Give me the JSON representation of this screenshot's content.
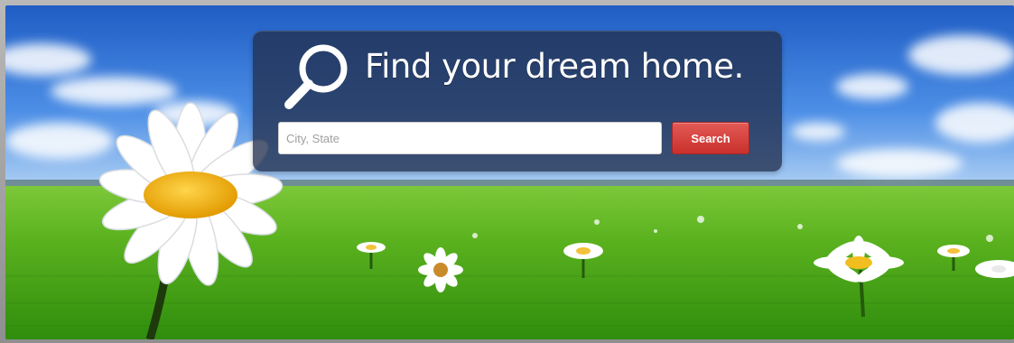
{
  "hero": {
    "background_image": "meadow-with-daisies-under-blue-sky",
    "colors": {
      "sky": "#2f6fd0",
      "grass": "#5fb11e",
      "daisy_petal": "#ffffff",
      "daisy_center": "#f4b400"
    }
  },
  "search_panel": {
    "icon": "magnifying-glass-icon",
    "headline": "Find your dream home.",
    "input_placeholder": "City, State",
    "input_value": "",
    "button_label": "Search",
    "colors": {
      "panel": "#22304e",
      "button": "#d5413c",
      "headline": "#ffffff"
    }
  }
}
